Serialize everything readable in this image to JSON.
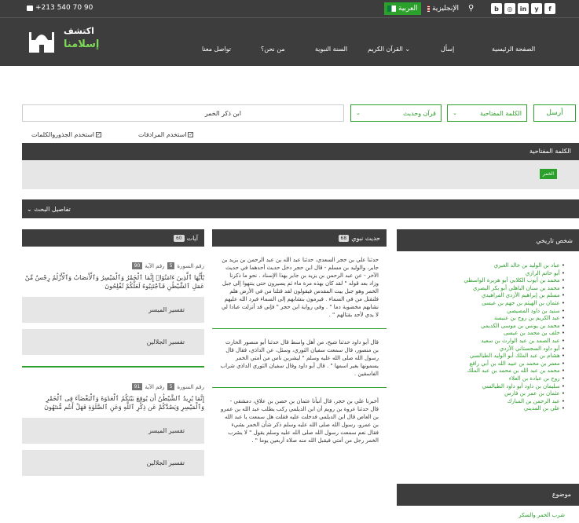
{
  "topbar": {
    "phone": "+213 540 70 90",
    "lang_ar": "العربية",
    "lang_en": "الإنجليزية",
    "social": [
      "b",
      "◎",
      "in",
      "y",
      "f"
    ]
  },
  "logo": {
    "line1": "اكتشف",
    "line2": "إسلامنا"
  },
  "nav": [
    "الصفحة الرئيسية",
    "إسأل",
    "القرآن الكريم ⌄",
    "السنة النبوية",
    "من نحن؟",
    "تواصل معنا"
  ],
  "search": {
    "send": "أرسل",
    "type": "الكلمة المفتاحية",
    "source": "قرآن وحديث",
    "query": "ابن ذكر الخمر",
    "chk_synonyms": "استخدم المرادفات",
    "chk_roots": "استخدم الجذوروالكلمات"
  },
  "keyword": {
    "title": "الكلمة المفتاحية",
    "tag": "الخمر"
  },
  "details": "⌄ تفاصيل البحث",
  "columns": {
    "ayat": {
      "title": "آيات",
      "count": "60"
    },
    "hadith": {
      "title": "حديث نبوي",
      "count": "68"
    },
    "person": {
      "title": "شخص تاريخي"
    }
  },
  "ayat": [
    {
      "surah_label": "رقم السورة",
      "surah": "5",
      "ayah_label": "رقم الآية",
      "ayah": "90",
      "text": "يَٰٓأَيُّهَا ٱلَّذِينَ ءَامَنُوٓا۟ إِنَّمَا ٱلْخَمْرُ وَٱلْمَيْسِرُ وَٱلْأَنصَابُ وَٱلْأَزْلَٰمُ رِجْسٌ مِّنْ عَمَلِ ٱلشَّيْطَٰنِ فَٱجْتَنِبُوهُ لَعَلَّكُمْ تُفْلِحُونَ",
      "t1": "تفسير الميسر",
      "t2": "تفسير الجلالين"
    },
    {
      "surah_label": "رقم السورة",
      "surah": "5",
      "ayah_label": "رقم الآية",
      "ayah": "91",
      "text": "إِنَّمَا يُرِيدُ ٱلشَّيْطَٰنُ أَن يُوقِعَ بَيْنَكُمُ ٱلْعَدَٰوَةَ وَٱلْبَغْضَآءَ فِى ٱلْخَمْرِ وَٱلْمَيْسِرِ وَيَصُدَّكُمْ عَن ذِكْرِ ٱللَّهِ وَعَنِ ٱلصَّلَوٰةِ فَهَلْ أَنتُم مُّنتَهُونَ",
      "t1": "تفسير الميسر",
      "t2": "تفسير الجلالين"
    }
  ],
  "hadiths": [
    "حدثنا علي بن حجر السعدي، حدثنا عبد الله بن عبد الرحمن بن يزيد بن جابر، والوليد بن مسلم - قال ابن حجر دخل حديث أحدهما في حديث الآخر - عن عبد الرحمن بن يزيد بن جابر بهذا الإسناد . نحو ما ذكرنا وزاد بعد قوله \" لقد كان بهذه مرة ماء ثم يسيرون حتى ينتهوا إلى جبل الخمر وهو جبل بيت المقدس فيقولون لقد قتلنا من في الأرض هلم فلنقتل من في السماء . فيرمون بنشابهم إلى السماء فيرد الله عليهم نشابهم مخضوبة دما \" . وفي رواية ابن حجر \" فإني قد أنزلت عبادا لي لا يدي لأحد بقتالهم \" .",
    "قال أبو داود حدثنا شيخ، من أهل واسط قال حدثنا أبو منصور الحارث بن منصور، قال سمعت سفيان الثوري، وسئل، عن الداذي، فقال قال رسول الله صلى الله عليه وسلم \" ليشربن ناس من أمتي الخمر يسمونها بغير اسمها \" . قال أبو داود وقال سفيان الثوري الداذي شراب الفاسقين .",
    "أخبرنا علي بن حجر، قال أنبأنا عثمان بن حصن بن علاق، دمشقي - قال حدثنا عروة بن رويم أن ابن الديلمي ركب يطلب عبد الله بن عمرو بن العاص قال ابن الديلمي فدخلت عليه فقلت هل سمعت يا عبد الله بن عمرو، رسول الله صلى الله عليه وسلم ذكر شأن الخمر بشيء فقال نعم سمعت رسول الله صلى الله عليه وسلم يقول \" لا يشرب الخمر رجل من أمتي فيقبل الله منه صلاة أربعين يوما \" ."
  ],
  "persons": [
    "عباد بن الوليد بن خالد الغبري",
    "أبو حاتم الرازي",
    "محمد بن أيوب الكلابي أبو هريرة الواسطي",
    "محمد بن سنان الباهلي أبو بكر البصري",
    "مسلم بن إبراهيم الأزدي الفراهيدي",
    "عثمان بن الهيثم بن جهم بن عيسى",
    "سنيد بن داود المصيصي",
    "عبد الكريم بن روح بن عنبسة",
    "محمد بن يونس بن موسى الكديمي",
    "خلف بن محمد بن عيسى",
    "عبد الصمد بن عبد الوارث بن سعيد",
    "أبو داود السجستاني الأزدي",
    "هشام بن عبد الملك أبو الوليد الطيالسي",
    "معمر بن محمد بن عبيد الله بن أبي رافع",
    "محمد بن عبد الله بن محمد بن عبد الملك",
    "روح بن عبادة بن العلاء",
    "سليمان بن داود أبو داود الطيالسي",
    "عثمان بن عمر بن فارس",
    "عبد الرحمن بن المبارك",
    "علي بن المديني"
  ],
  "topic": {
    "title": "موضوع",
    "item": "شرب الخمر والسكر"
  }
}
